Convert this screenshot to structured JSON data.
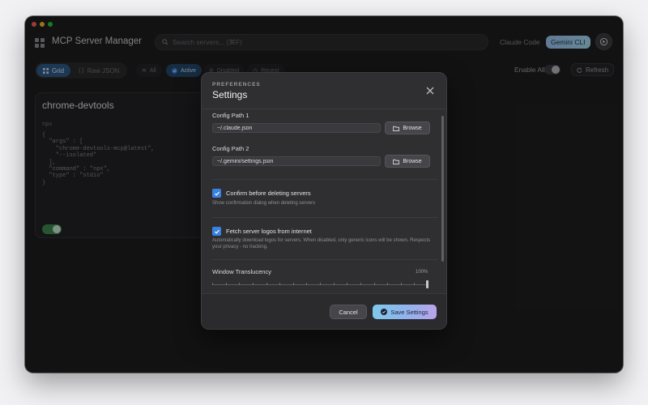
{
  "app": {
    "title": "MCP Server Manager"
  },
  "search": {
    "placeholder": "Search servers... (⌘F)"
  },
  "clients": {
    "claude_code": "Claude Code",
    "gemini_cli": "Gemini CLI"
  },
  "view_toggle": {
    "grid": "Grid",
    "raw_json": "Raw JSON",
    "selected": "Grid"
  },
  "filters": [
    {
      "label": "All",
      "active": false
    },
    {
      "label": "Active",
      "active": true
    },
    {
      "label": "Disabled",
      "active": false
    },
    {
      "label": "Recent",
      "active": false
    }
  ],
  "toolbar": {
    "enable_all": "Enable All",
    "enable_all_on": false,
    "refresh": "Refresh"
  },
  "server_card": {
    "name": "chrome-devtools",
    "command": "npx",
    "config": "{\n  \"args\" : [\n    \"chrome-devtools-mcp@latest\",\n    \"--isolated\"\n  ],\n  \"command\" : \"npx\",\n  \"type\" : \"stdio\"\n}",
    "enabled": true
  },
  "settings": {
    "kicker": "PREFERENCES",
    "title": "Settings",
    "config_path_1": {
      "label": "Config Path 1",
      "value": "~/.claude.json",
      "browse": "Browse"
    },
    "config_path_2": {
      "label": "Config Path 2",
      "value": "~/.gemini/settings.json",
      "browse": "Browse"
    },
    "confirm_delete": {
      "label": "Confirm before deleting servers",
      "description": "Show confirmation dialog when deleting servers",
      "checked": true
    },
    "fetch_logos": {
      "label": "Fetch server logos from internet",
      "description": "Automatically download logos for servers. When disabled, only generic icons will be shown. Respects your privacy - no tracking.",
      "checked": true
    },
    "translucency": {
      "label": "Window Translucency",
      "value_text": "100%",
      "value": 1.0
    },
    "cancel": "Cancel",
    "save": "Save Settings"
  },
  "colors": {
    "accent": "#3a82e0",
    "enabled_green": "#3e8a52",
    "save_gradient_start": "#7fc8ea",
    "save_gradient_end": "#b9a4ea"
  },
  "icons": {
    "app": "grid-icon",
    "search": "search-icon",
    "close": "close-icon",
    "folder": "folder-icon",
    "check": "check-icon",
    "refresh": "refresh-icon",
    "settings": "settings-icon"
  }
}
